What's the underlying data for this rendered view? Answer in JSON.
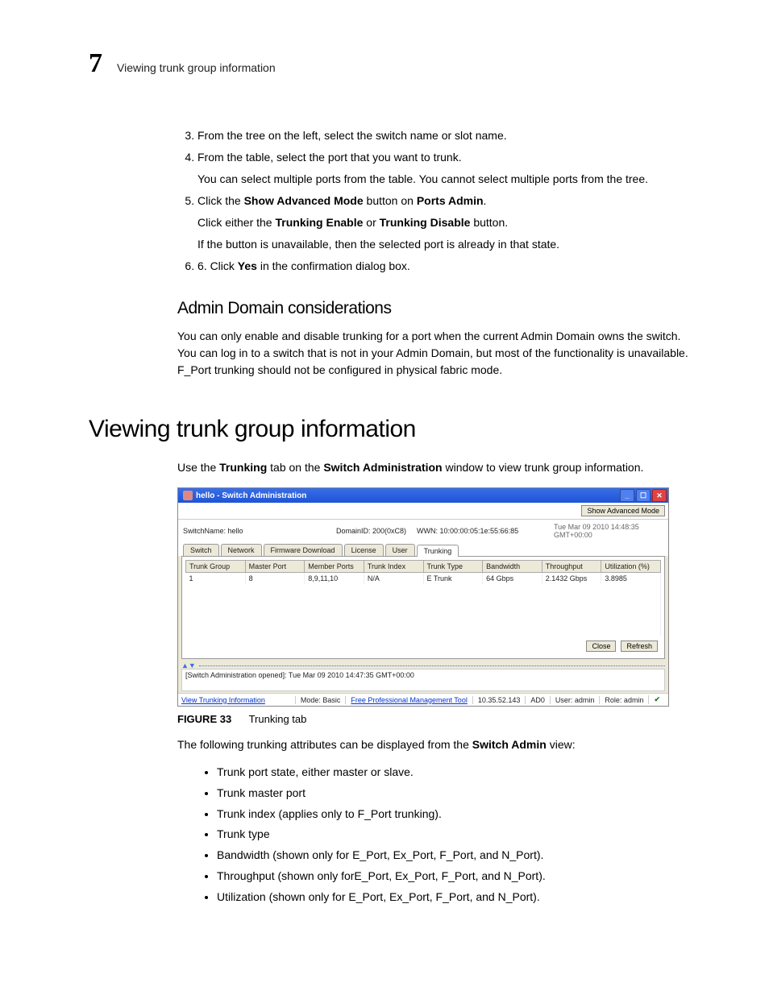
{
  "header": {
    "chapter_number": "7",
    "running_title": "Viewing trunk group information"
  },
  "steps": [
    {
      "num": "3.",
      "text": "From the tree on the left, select the switch name or slot name."
    },
    {
      "num": "4.",
      "text": "From the table, select the port that you want to trunk.",
      "sub": [
        "You can select multiple ports from the table. You cannot select multiple ports from the tree."
      ]
    },
    {
      "num": "5.",
      "prefix": "Click the ",
      "bold1": "Show Advanced Mode",
      "mid1": " button on ",
      "bold2": "Ports Admin",
      "suffix": ".",
      "sub5a_pre": "Click either the ",
      "sub5a_b1": "Trunking Enable",
      "sub5a_mid": " or ",
      "sub5a_b2": "Trunking Disable",
      "sub5a_post": " button.",
      "sub5b": "If the button is unavailable, then the selected port is already in that state."
    },
    {
      "num": "6.",
      "prefix": "6. Click ",
      "bold1": "Yes",
      "suffix": " in the confirmation dialog box."
    }
  ],
  "section2_heading": "Admin Domain considerations",
  "section2_para": "You can only enable and disable trunking for a port when the current Admin Domain owns the switch. You can log in to a switch that is not in your Admin Domain, but most of the functionality is unavailable. F_Port trunking should not be configured in physical fabric mode.",
  "h1": "Viewing trunk group information",
  "intro_pre": "Use the ",
  "intro_b1": "Trunking",
  "intro_mid": " tab on the ",
  "intro_b2": "Switch Administration",
  "intro_post": " window to view trunk group information.",
  "window": {
    "title": "hello - Switch Administration",
    "show_adv_btn": "Show Advanced Mode",
    "switchname_label": "SwitchName: hello",
    "domainid": "DomainID: 200(0xC8)",
    "wwn": "WWN: 10:00:00:05:1e:55:66:85",
    "timestamp": "Tue Mar 09 2010 14:48:35 GMT+00:00",
    "tabs": [
      "Switch",
      "Network",
      "Firmware Download",
      "License",
      "User",
      "Trunking"
    ],
    "columns": [
      "Trunk Group",
      "Master Port",
      "Member Ports",
      "Trunk Index",
      "Trunk Type",
      "Bandwidth",
      "Throughput",
      "Utilization (%)"
    ],
    "row": [
      "1",
      "8",
      "8,9,11,10",
      "N/A",
      "E Trunk",
      "64 Gbps",
      "2.1432 Gbps",
      "3.8985"
    ],
    "close_btn": "Close",
    "refresh_btn": "Refresh",
    "log": "[Switch Administration opened]: Tue Mar 09 2010 14:47:35 GMT+00:00",
    "status": {
      "view": "View Trunking Information",
      "mode": "Mode: Basic",
      "link": "Free Professional Management Tool",
      "ip": "10.35.52.143",
      "ad": "AD0",
      "user": "User: admin",
      "role": "Role: admin"
    }
  },
  "figure": {
    "label": "FIGURE 33",
    "caption": "Trunking tab"
  },
  "attrs_intro_pre": "The following trunking attributes can be displayed from the ",
  "attrs_intro_b": "Switch Admin",
  "attrs_intro_post": " view:",
  "attrs": [
    "Trunk port state, either master or slave.",
    "Trunk master port",
    "Trunk index (applies only to F_Port trunking).",
    "Trunk type",
    "Bandwidth (shown only for E_Port, Ex_Port, F_Port, and N_Port).",
    "Throughput (shown only forE_Port, Ex_Port, F_Port, and N_Port).",
    "Utilization (shown only for E_Port, Ex_Port, F_Port, and N_Port)."
  ]
}
